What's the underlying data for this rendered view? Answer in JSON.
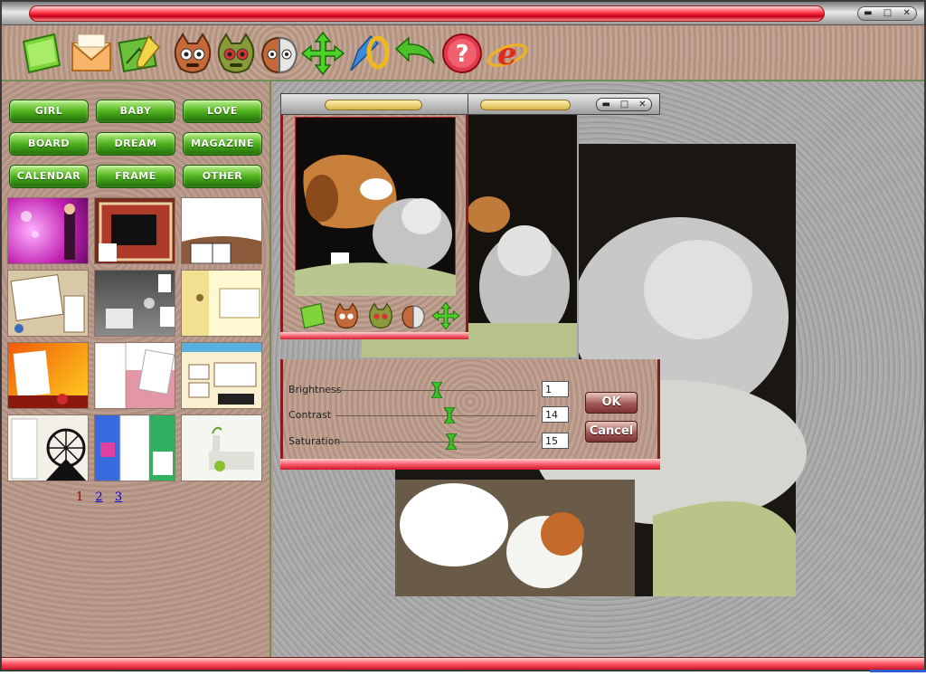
{
  "window": {
    "controls": [
      "▬",
      "□",
      "✕"
    ]
  },
  "toolbar": {
    "tools": [
      {
        "name": "open-folder",
        "icon": "folder-icon"
      },
      {
        "name": "save-envelope",
        "icon": "envelope-icon"
      },
      {
        "name": "edit-photo",
        "icon": "photo-pencil-icon"
      },
      {
        "name": "face-gray",
        "icon": "monster-face-icon"
      },
      {
        "name": "face-green",
        "icon": "monster-face-green-icon"
      },
      {
        "name": "face-half",
        "icon": "monster-face-half-icon"
      },
      {
        "name": "move",
        "icon": "move-arrows-icon"
      },
      {
        "name": "text-tool",
        "icon": "pencil-shape-icon"
      },
      {
        "name": "undo",
        "icon": "undo-arrow-icon"
      },
      {
        "name": "help",
        "icon": "help-icon"
      },
      {
        "name": "internet",
        "icon": "ie-browser-icon"
      }
    ],
    "help_glyph": "?",
    "ie_glyph": "e"
  },
  "categories": [
    "GIRL",
    "BABY",
    "LOVE",
    "BOARD",
    "DREAM",
    "MAGAZINE",
    "CALENDAR",
    "FRAME",
    "OTHER"
  ],
  "pagination": {
    "pages": [
      "1",
      "2",
      "3"
    ],
    "current": "1"
  },
  "dialog": {
    "controls": [
      "▬",
      "□",
      "✕"
    ],
    "sliders": [
      {
        "label": "Brightness",
        "value": "1"
      },
      {
        "label": "Contrast",
        "value": "14"
      },
      {
        "label": "Saturation",
        "value": "15"
      }
    ],
    "ok_label": "OK",
    "cancel_label": "Cancel"
  },
  "colors": {
    "accent_red": "#ff3344",
    "category_green": "#4fb21e",
    "panel_brown": "#b89a8c"
  }
}
